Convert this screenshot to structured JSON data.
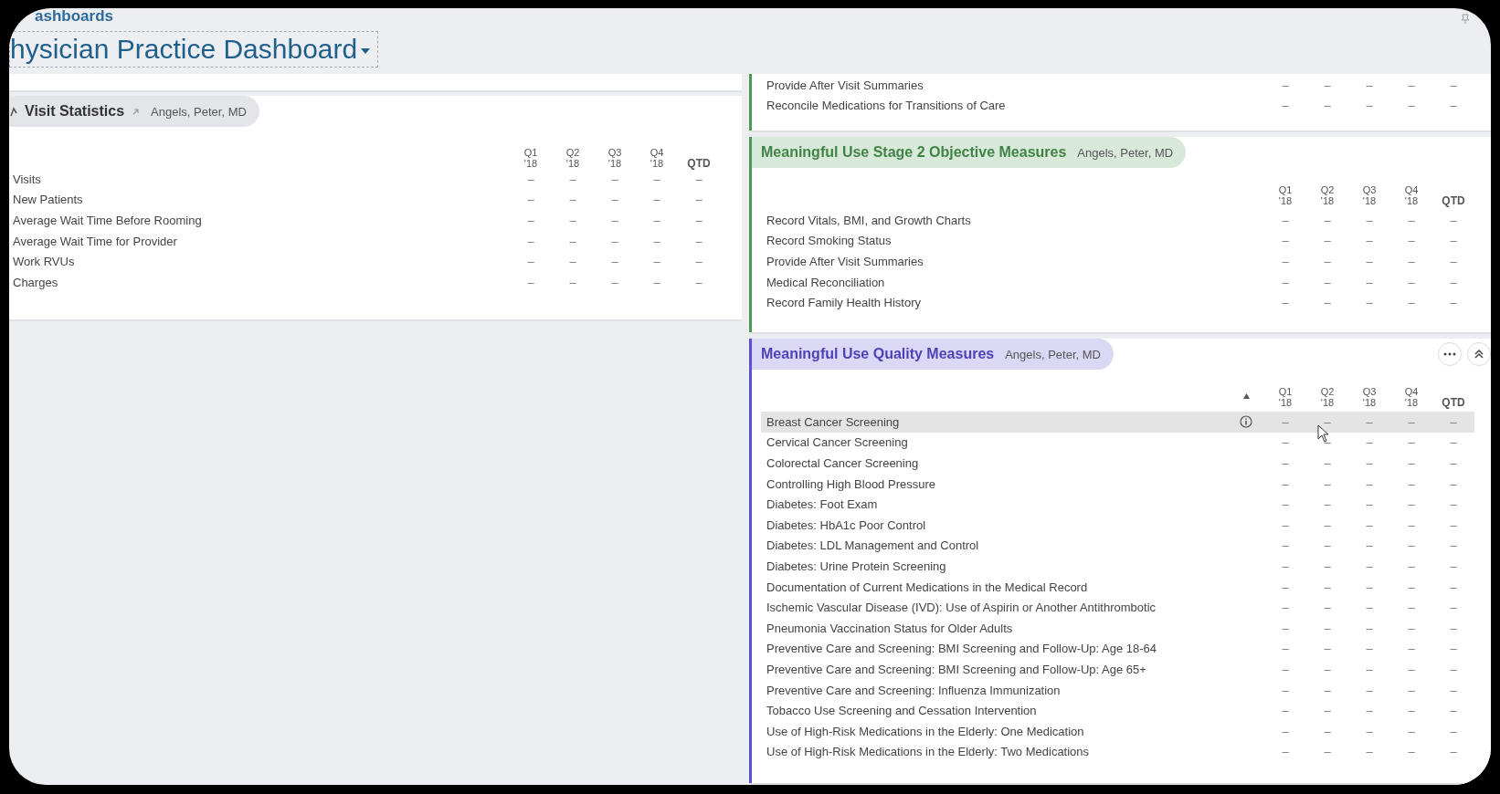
{
  "breadcrumb": "ashboards",
  "title": "hysician Practice Dashboard",
  "left_panels": [
    {
      "title": "Visit Statistics",
      "provider": "Angels, Peter, MD",
      "color": "#e4e5e8",
      "columns": [
        {
          "label": "Q1",
          "year": "'18",
          "kind": "quarter"
        },
        {
          "label": "Q2",
          "year": "'18",
          "kind": "quarter"
        },
        {
          "label": "Q3",
          "year": "'18",
          "kind": "quarter"
        },
        {
          "label": "Q4",
          "year": "'18",
          "kind": "quarter"
        },
        {
          "label": "QTD",
          "kind": "total"
        }
      ],
      "rows": [
        {
          "label": "Visits",
          "values": [
            "–",
            "–",
            "–",
            "–",
            "–"
          ]
        },
        {
          "label": "New Patients",
          "values": [
            "–",
            "–",
            "–",
            "–",
            "–"
          ]
        },
        {
          "label": "Average Wait Time Before Rooming",
          "values": [
            "–",
            "–",
            "–",
            "–",
            "–"
          ]
        },
        {
          "label": "Average Wait Time for Provider",
          "values": [
            "–",
            "–",
            "–",
            "–",
            "–"
          ]
        },
        {
          "label": "Work RVUs",
          "values": [
            "–",
            "–",
            "–",
            "–",
            "–"
          ]
        },
        {
          "label": "Charges",
          "values": [
            "–",
            "–",
            "–",
            "–",
            "–"
          ]
        }
      ]
    }
  ],
  "right_panels": [
    {
      "kind": "continued",
      "color": "#4c9a52",
      "rows": [
        {
          "label": "Provide After Visit Summaries",
          "values": [
            "–",
            "–",
            "–",
            "–",
            "–"
          ]
        },
        {
          "label": "Reconcile Medications for Transitions of Care",
          "values": [
            "–",
            "–",
            "–",
            "–",
            "–"
          ]
        }
      ]
    },
    {
      "title": "Meaningful Use Stage 2 Objective Measures",
      "provider": "Angels, Peter, MD",
      "kind": "objective",
      "color": "#4c9a52",
      "columns": [
        {
          "label": "Q1",
          "year": "'18",
          "kind": "quarter"
        },
        {
          "label": "Q2",
          "year": "'18",
          "kind": "quarter"
        },
        {
          "label": "Q3",
          "year": "'18",
          "kind": "quarter"
        },
        {
          "label": "Q4",
          "year": "'18",
          "kind": "quarter"
        },
        {
          "label": "QTD",
          "kind": "total"
        }
      ],
      "rows": [
        {
          "label": "Record Vitals, BMI, and Growth Charts",
          "values": [
            "–",
            "–",
            "–",
            "–",
            "–"
          ]
        },
        {
          "label": "Record Smoking Status",
          "values": [
            "–",
            "–",
            "–",
            "–",
            "–"
          ]
        },
        {
          "label": "Provide After Visit Summaries",
          "values": [
            "–",
            "–",
            "–",
            "–",
            "–"
          ]
        },
        {
          "label": "Medical Reconciliation",
          "values": [
            "–",
            "–",
            "–",
            "–",
            "–"
          ]
        },
        {
          "label": "Record Family Health History",
          "values": [
            "–",
            "–",
            "–",
            "–",
            "–"
          ]
        }
      ]
    },
    {
      "title": "Meaningful Use Quality Measures",
      "provider": "Angels, Peter, MD",
      "kind": "quality",
      "color": "#5b4fd6",
      "columns": [
        {
          "label": "Q1",
          "year": "'18",
          "kind": "quarter"
        },
        {
          "label": "Q2",
          "year": "'18",
          "kind": "quarter"
        },
        {
          "label": "Q3",
          "year": "'18",
          "kind": "quarter"
        },
        {
          "label": "Q4",
          "year": "'18",
          "kind": "quarter"
        },
        {
          "label": "QTD",
          "kind": "total"
        }
      ],
      "rows": [
        {
          "label": "Breast Cancer Screening",
          "values": [
            "–",
            "–",
            "–",
            "–",
            "–"
          ],
          "selected": true
        },
        {
          "label": "Cervical Cancer Screening",
          "values": [
            "–",
            "–",
            "–",
            "–",
            "–"
          ],
          "selected": false
        },
        {
          "label": "Colorectal Cancer Screening",
          "values": [
            "–",
            "–",
            "–",
            "–",
            "–"
          ],
          "selected": false
        },
        {
          "label": "Controlling High Blood Pressure",
          "values": [
            "–",
            "–",
            "–",
            "–",
            "–"
          ],
          "selected": false
        },
        {
          "label": "Diabetes: Foot Exam",
          "values": [
            "–",
            "–",
            "–",
            "–",
            "–"
          ],
          "selected": false
        },
        {
          "label": "Diabetes: HbA1c Poor Control",
          "values": [
            "–",
            "–",
            "–",
            "–",
            "–"
          ],
          "selected": false
        },
        {
          "label": "Diabetes: LDL Management and Control",
          "values": [
            "–",
            "–",
            "–",
            "–",
            "–"
          ],
          "selected": false
        },
        {
          "label": "Diabetes: Urine Protein Screening",
          "values": [
            "–",
            "–",
            "–",
            "–",
            "–"
          ],
          "selected": false
        },
        {
          "label": "Documentation of Current Medications in the Medical Record",
          "values": [
            "–",
            "–",
            "–",
            "–",
            "–"
          ],
          "selected": false
        },
        {
          "label": "Ischemic Vascular Disease (IVD): Use of Aspirin or Another Antithrombotic",
          "values": [
            "–",
            "–",
            "–",
            "–",
            "–"
          ],
          "selected": false
        },
        {
          "label": "Pneumonia Vaccination Status for Older Adults",
          "values": [
            "–",
            "–",
            "–",
            "–",
            "–"
          ],
          "selected": false
        },
        {
          "label": "Preventive Care and Screening: BMI Screening and Follow-Up: Age 18-64",
          "values": [
            "–",
            "–",
            "–",
            "–",
            "–"
          ],
          "selected": false
        },
        {
          "label": "Preventive Care and Screening: BMI Screening and Follow-Up: Age 65+",
          "values": [
            "–",
            "–",
            "–",
            "–",
            "–"
          ],
          "selected": false
        },
        {
          "label": "Preventive Care and Screening: Influenza Immunization",
          "values": [
            "–",
            "–",
            "–",
            "–",
            "–"
          ],
          "selected": false
        },
        {
          "label": "Tobacco Use Screening and Cessation Intervention",
          "values": [
            "–",
            "–",
            "–",
            "–",
            "–"
          ],
          "selected": false
        },
        {
          "label": "Use of High-Risk Medications in the Elderly: One Medication",
          "values": [
            "–",
            "–",
            "–",
            "–",
            "–"
          ],
          "selected": false
        },
        {
          "label": "Use of High-Risk Medications in the Elderly: Two Medications",
          "values": [
            "–",
            "–",
            "–",
            "–",
            "–"
          ],
          "selected": false
        }
      ]
    }
  ]
}
